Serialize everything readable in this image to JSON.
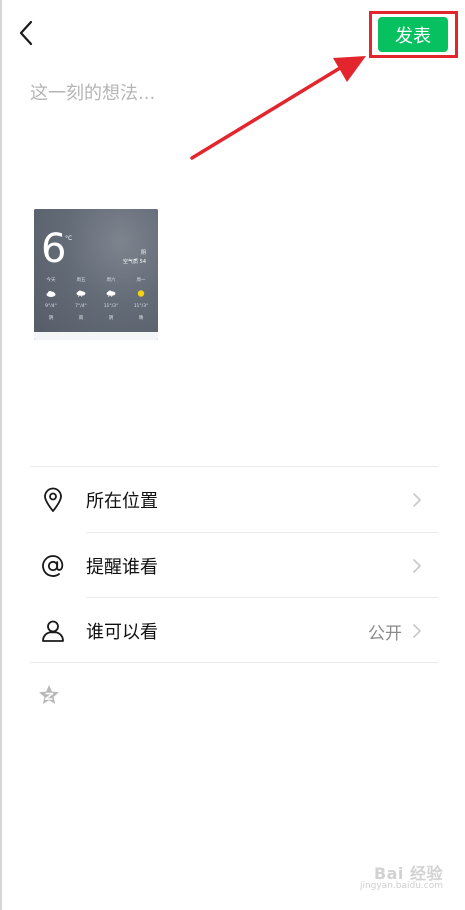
{
  "header": {
    "publish_label": "发表"
  },
  "composer": {
    "placeholder": "这一刻的想法..."
  },
  "photo": {
    "temperature": "6",
    "unit": "°C",
    "condition": "阴",
    "air_quality": "空气质 54",
    "forecast": [
      {
        "day": "今天",
        "icon": "cloud-icon",
        "range": "9°/4°",
        "desc": "阴"
      },
      {
        "day": "周五",
        "icon": "cloud-rain-icon",
        "range": "7°/4°",
        "desc": "雨"
      },
      {
        "day": "周六",
        "icon": "cloud-rain-icon",
        "range": "11°/3°",
        "desc": "阴"
      },
      {
        "day": "周一",
        "icon": "sun-icon",
        "range": "11°/3°",
        "desc": "晴"
      }
    ]
  },
  "options": [
    {
      "icon": "location-pin-icon",
      "label": "所在位置",
      "value": ""
    },
    {
      "icon": "at-sign-icon",
      "label": "提醒谁看",
      "value": ""
    },
    {
      "icon": "person-icon",
      "label": "谁可以看",
      "value": "公开"
    }
  ],
  "watermark": {
    "logo": "Bai 经验",
    "sub": "jingyan.baidu.com"
  },
  "colors": {
    "accent_green": "#07c160",
    "highlight_red": "#e3262d"
  }
}
